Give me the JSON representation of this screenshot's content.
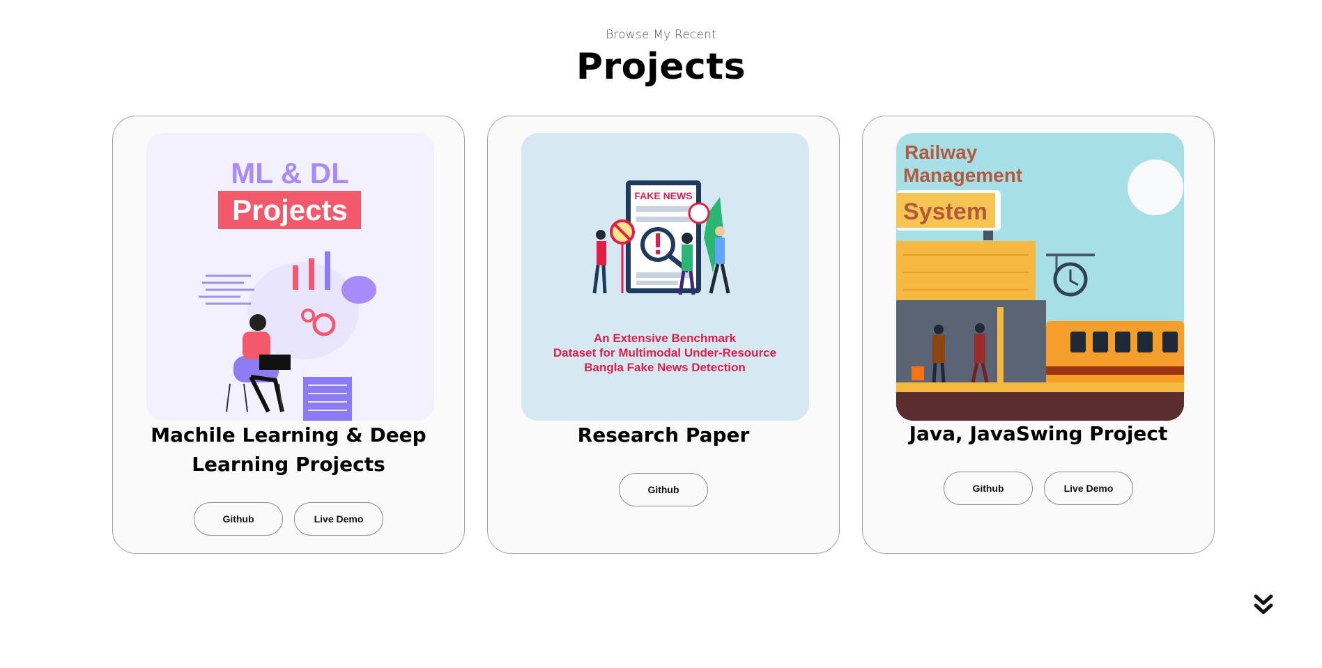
{
  "header": {
    "subtitle": "Browse My Recent",
    "title": "Projects"
  },
  "projects": [
    {
      "title": "Machile Learning & Deep Learning Projects",
      "image_text": {
        "line1": "ML & DL",
        "line2": "Projects"
      },
      "buttons": [
        "Github",
        "Live Demo"
      ]
    },
    {
      "title": "Research Paper",
      "image_text": {
        "badge": "FAKE NEWS",
        "line1": "An Extensive Benchmark",
        "line2": "Dataset for Multimodal Under-Resource",
        "line3": "Bangla Fake News Detection"
      },
      "buttons": [
        "Github"
      ]
    },
    {
      "title": "Java, JavaSwing Project",
      "image_text": {
        "line1": "Railway",
        "line2": "Management",
        "line3": "System"
      },
      "buttons": [
        "Github",
        "Live Demo"
      ]
    }
  ],
  "icons": {
    "scroll": "double-chevron-down-icon"
  },
  "colors": {
    "ml_purple": "#a78bfa",
    "ml_red": "#f2596b",
    "fake_news_red": "#e11d48",
    "railway_sky": "#a7dfe6",
    "railway_orange": "#f5a63a"
  }
}
